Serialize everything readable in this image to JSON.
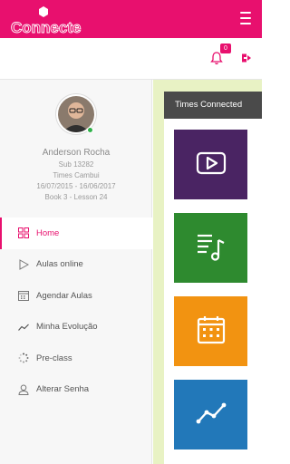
{
  "app": {
    "logo_text": "Connecte"
  },
  "header": {
    "notification_count": "0"
  },
  "profile": {
    "name": "Anderson Rocha",
    "sub": "Sub 13282",
    "team": "Times Cambui",
    "period": "16/07/2015 - 16/06/2017",
    "book": "Book 3 - Lesson 24"
  },
  "nav": {
    "items": [
      {
        "label": "Home",
        "icon": "grid-icon",
        "active": true
      },
      {
        "label": "Aulas online",
        "icon": "play-outline-icon",
        "active": false
      },
      {
        "label": "Agendar Aulas",
        "icon": "calendar-icon",
        "active": false
      },
      {
        "label": "Minha Evolução",
        "icon": "trend-line-icon",
        "active": false
      },
      {
        "label": "Pre-class",
        "icon": "spinner-icon",
        "active": false
      },
      {
        "label": "Alterar Senha",
        "icon": "user-icon",
        "active": false
      }
    ]
  },
  "panel": {
    "title": "Times Connected"
  },
  "tiles": [
    {
      "icon": "video-play-icon",
      "color": "#4a2463"
    },
    {
      "icon": "music-note-icon",
      "color": "#2e8a2f"
    },
    {
      "icon": "calendar-icon",
      "color": "#f29311"
    },
    {
      "icon": "chart-line-icon",
      "color": "#2278b9"
    }
  ],
  "colors": {
    "brand": "#e8106e",
    "sidebar_bg": "#f7f7f7",
    "content_bg": "#e8f2c4"
  }
}
